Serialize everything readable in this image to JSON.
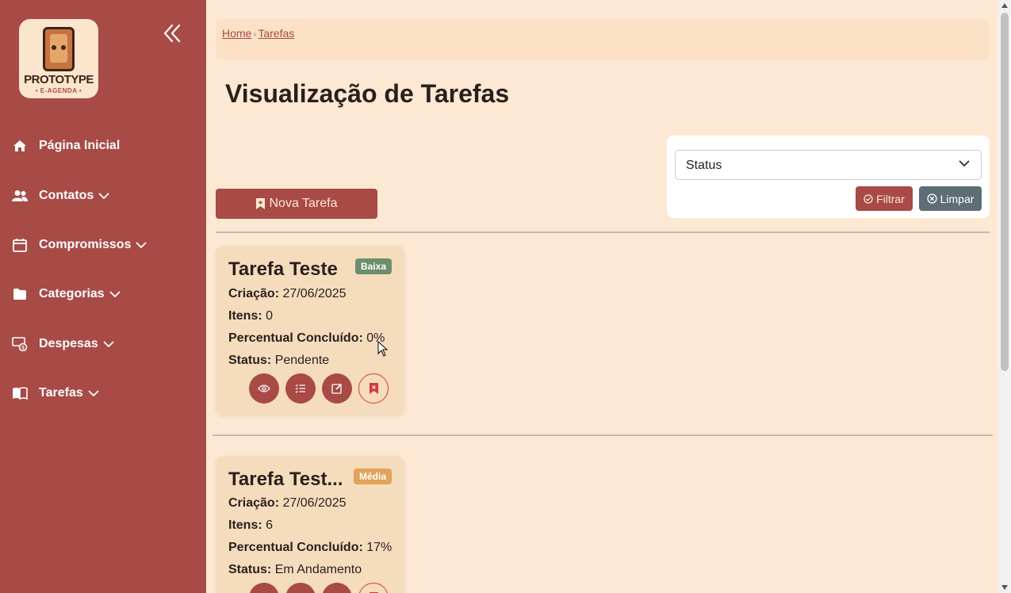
{
  "sidebar": {
    "logo": {
      "title": "PROTOTYPE",
      "subtitle": "• E-AGENDA •"
    },
    "items": [
      {
        "label": "Página Inicial",
        "icon": "home-icon",
        "has_dropdown": false
      },
      {
        "label": "Contatos",
        "icon": "users-icon",
        "has_dropdown": true
      },
      {
        "label": "Compromissos",
        "icon": "calendar-icon",
        "has_dropdown": true
      },
      {
        "label": "Categorias",
        "icon": "folder-icon",
        "has_dropdown": true
      },
      {
        "label": "Despesas",
        "icon": "money-icon",
        "has_dropdown": true
      },
      {
        "label": "Tarefas",
        "icon": "book-icon",
        "has_dropdown": true
      }
    ]
  },
  "breadcrumb": {
    "home": "Home",
    "current": "Tarefas"
  },
  "page_title": "Visualização de Tarefas",
  "filter": {
    "status_selected": "Status",
    "filter_button": "Filtrar",
    "clear_button": "Limpar"
  },
  "new_task_button": "Nova Tarefa",
  "tasks": [
    {
      "title": "Tarefa Teste",
      "priority": "Baixa",
      "priority_color": "#6a8f6a",
      "created_label": "Criação:",
      "created": "27/06/2025",
      "items_label": "Itens:",
      "items": "0",
      "percent_label": "Percentual Concluído:",
      "percent": "0%",
      "status_label": "Status:",
      "status": "Pendente"
    },
    {
      "title": "Tarefa Test...",
      "priority": "Média",
      "priority_color": "#e0a45a",
      "created_label": "Criação:",
      "created": "27/06/2025",
      "items_label": "Itens:",
      "items": "6",
      "percent_label": "Percentual Concluído:",
      "percent": "17%",
      "status_label": "Status:",
      "status": "Em Andamento"
    }
  ],
  "colors": {
    "sidebar": "#a84a46",
    "background": "#fde9d3",
    "card": "#f4dcbd",
    "accent": "#a84a46",
    "secondary": "#5f6e76"
  }
}
